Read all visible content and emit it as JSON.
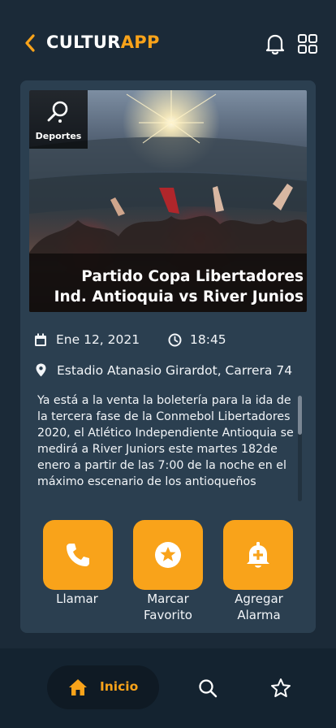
{
  "app": {
    "brand_part1": "CULTUR",
    "brand_part2": "APP",
    "accent": "#f9a31a",
    "background": "#1b2a38",
    "card_background": "#2b3f50"
  },
  "header": {
    "icons": [
      "back-chevron-icon",
      "bell-icon",
      "grid-icon"
    ]
  },
  "event": {
    "category": "Deportes",
    "category_icon": "magnifier-search-icon",
    "title_line1": "Partido Copa Libertadores",
    "title_line2": "Ind. Antioquia vs River Junios",
    "date": "Ene 12, 2021",
    "time": "18:45",
    "location": "Estadio Atanasio Girardot, Carrera 74",
    "description": "Ya está a la venta la boletería para la ida de la tercera fase de la Conmebol Libertadores 2020, el Atlético Independiente Antioquia se medirá a River Juniors este martes 182de enero a partir de las 7:00 de la noche en el máximo escenario de los antioqueños"
  },
  "actions": [
    {
      "label_line1": "Llamar",
      "label_line2": "",
      "icon": "phone-icon"
    },
    {
      "label_line1": "Marcar",
      "label_line2": "Favorito",
      "icon": "star-circle-icon"
    },
    {
      "label_line1": "Agregar",
      "label_line2": "Alarma",
      "icon": "bell-add-icon"
    }
  ],
  "bottom_nav": {
    "home_label": "Inicio",
    "items": [
      "home-icon",
      "search-icon",
      "star-icon"
    ]
  }
}
